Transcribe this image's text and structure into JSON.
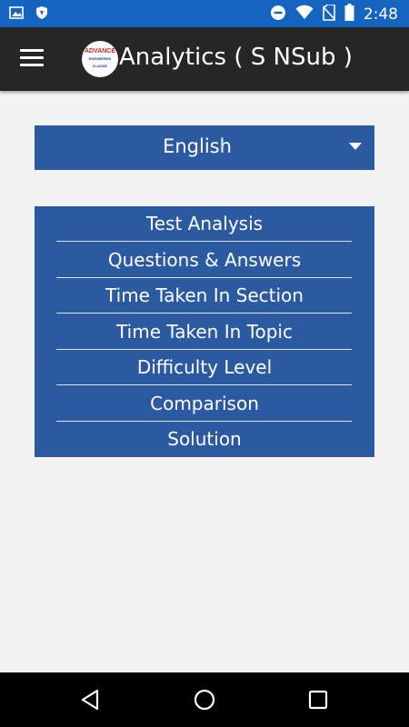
{
  "status": {
    "time": "2:48",
    "icons": [
      "image-icon",
      "shield-icon",
      "dnd-icon",
      "wifi-icon",
      "no-sim-icon",
      "battery-icon"
    ],
    "bar_color": "#1565c0"
  },
  "appbar": {
    "title": "Analytics ( S NSub )",
    "logo_text": "ADVANCE",
    "logo_subtext": "ENGINEERING CLASSES",
    "background": "#262626"
  },
  "language": {
    "selected": "English"
  },
  "analysis_menu": {
    "items": [
      {
        "label": "Test Analysis"
      },
      {
        "label": "Questions & Answers"
      },
      {
        "label": "Time Taken In Section"
      },
      {
        "label": "Time Taken In Topic"
      },
      {
        "label": "Difficulty Level"
      },
      {
        "label": "Comparison"
      },
      {
        "label": "Solution"
      }
    ],
    "accent": "#2c5aa0"
  },
  "navigation": {
    "buttons": [
      "back-icon",
      "home-icon",
      "recents-icon"
    ]
  }
}
